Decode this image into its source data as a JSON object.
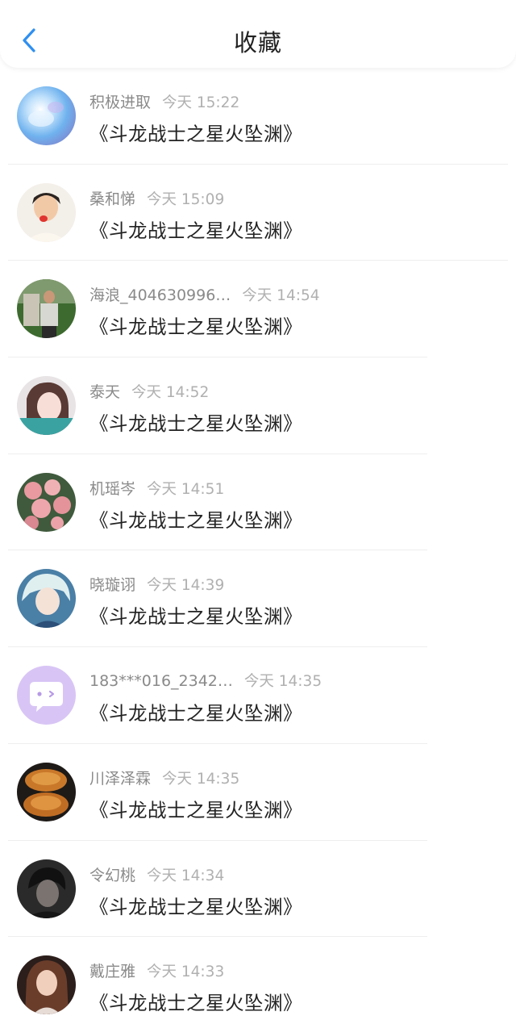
{
  "header": {
    "title": "收藏"
  },
  "colors": {
    "accent": "#2f8ff0",
    "name_gray": "#8a8a8a",
    "time_gray": "#b0b0b0",
    "title_text": "#222222"
  },
  "favorites": [
    {
      "user": "积极进取",
      "time": "今天 15:22",
      "title": "《斗龙战士之星火坠渊》",
      "avatar": "crystal-ball-avatar"
    },
    {
      "user": "桑和悌",
      "time": "今天 15:09",
      "title": "《斗龙战士之星火坠渊》",
      "avatar": "child-photo-avatar"
    },
    {
      "user": "海浪_404630996…",
      "time": "今天 14:54",
      "title": "《斗龙战士之星火坠渊》",
      "avatar": "man-outdoor-avatar"
    },
    {
      "user": "泰天",
      "time": "今天 14:52",
      "title": "《斗龙战士之星火坠渊》",
      "avatar": "girl-portrait-avatar"
    },
    {
      "user": "机瑶岑",
      "time": "今天 14:51",
      "title": "《斗龙战士之星火坠渊》",
      "avatar": "pink-flowers-avatar"
    },
    {
      "user": "晓璇诩",
      "time": "今天 14:39",
      "title": "《斗龙战士之星火坠渊》",
      "avatar": "anime-character-avatar"
    },
    {
      "user": "183***016_2342…",
      "time": "今天 14:35",
      "title": "《斗龙战士之星火坠渊》",
      "avatar": "default-chat-avatar"
    },
    {
      "user": "川泽泽霖",
      "time": "今天 14:35",
      "title": "《斗龙战士之星火坠渊》",
      "avatar": "mooncake-avatar"
    },
    {
      "user": "令幻桃",
      "time": "今天 14:34",
      "title": "《斗龙战士之星火坠渊》",
      "avatar": "dark-portrait-avatar"
    },
    {
      "user": "戴庄雅",
      "time": "今天 14:33",
      "title": "《斗龙战士之星火坠渊》",
      "avatar": "woman-portrait-avatar"
    }
  ]
}
